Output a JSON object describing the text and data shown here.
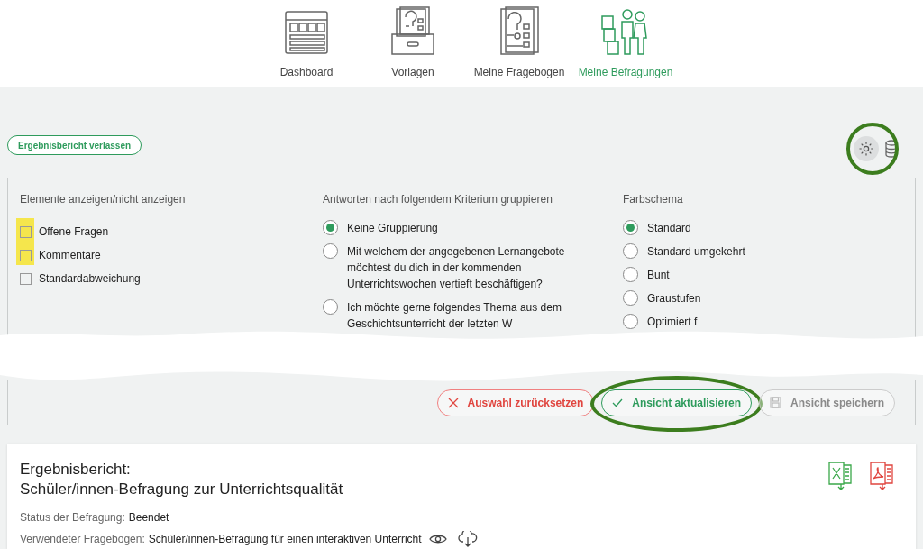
{
  "nav": [
    {
      "label": "Dashboard",
      "kind": "dashboard",
      "selected": false
    },
    {
      "label": "Vorlagen",
      "kind": "templates",
      "selected": false
    },
    {
      "label": "Meine Fragebogen",
      "kind": "questionnaires",
      "selected": false
    },
    {
      "label": "Meine Befragungen",
      "kind": "surveys",
      "selected": true
    }
  ],
  "leave_button": "Ergebnisbericht verlassen",
  "settings_highlighted": true,
  "panel": {
    "display": {
      "title": "Elemente anzeigen/nicht anzeigen",
      "items": [
        {
          "label": "Offene Fragen",
          "checked": false,
          "highlighted": true
        },
        {
          "label": "Kommentare",
          "checked": false,
          "highlighted": true
        },
        {
          "label": "Standardabweichung",
          "checked": false,
          "highlighted": false
        }
      ]
    },
    "grouping": {
      "title": "Antworten nach folgendem Kriterium gruppieren",
      "items": [
        {
          "label": "Keine Gruppierung",
          "selected": true
        },
        {
          "label": "Mit welchem der angegebenen Lernangebote möchtest du dich in der kommenden Unterrichtswochen vertieft beschäftigen?",
          "selected": false
        },
        {
          "label": "Ich möchte gerne folgendes Thema aus dem Geschichtsunterricht der letzten W",
          "selected": false
        }
      ]
    },
    "colors": {
      "title": "Farbschema",
      "items": [
        {
          "label": "Standard",
          "selected": true
        },
        {
          "label": "Standard umgekehrt",
          "selected": false
        },
        {
          "label": "Bunt",
          "selected": false
        },
        {
          "label": "Graustufen",
          "selected": false
        },
        {
          "label": "Optimiert f",
          "selected": false
        }
      ]
    }
  },
  "actions": [
    {
      "label": "Auswahl zurücksetzen",
      "kind": "reset",
      "disabled": false,
      "highlighted": false
    },
    {
      "label": "Ansicht aktualisieren",
      "kind": "update",
      "disabled": false,
      "highlighted": true
    },
    {
      "label": "Ansicht speichern",
      "kind": "save",
      "disabled": true,
      "highlighted": false
    }
  ],
  "report": {
    "heading": "Ergebnisbericht:",
    "title": "Schüler/innen-Befragung zur Unterrichtsqualität",
    "status_label": "Status der Befragung:",
    "status_value": "Beendet",
    "questionnaire_label": "Verwendeter Fragebogen:",
    "questionnaire_value": "Schüler/innen-Befragung für einen interaktiven Unterricht"
  }
}
